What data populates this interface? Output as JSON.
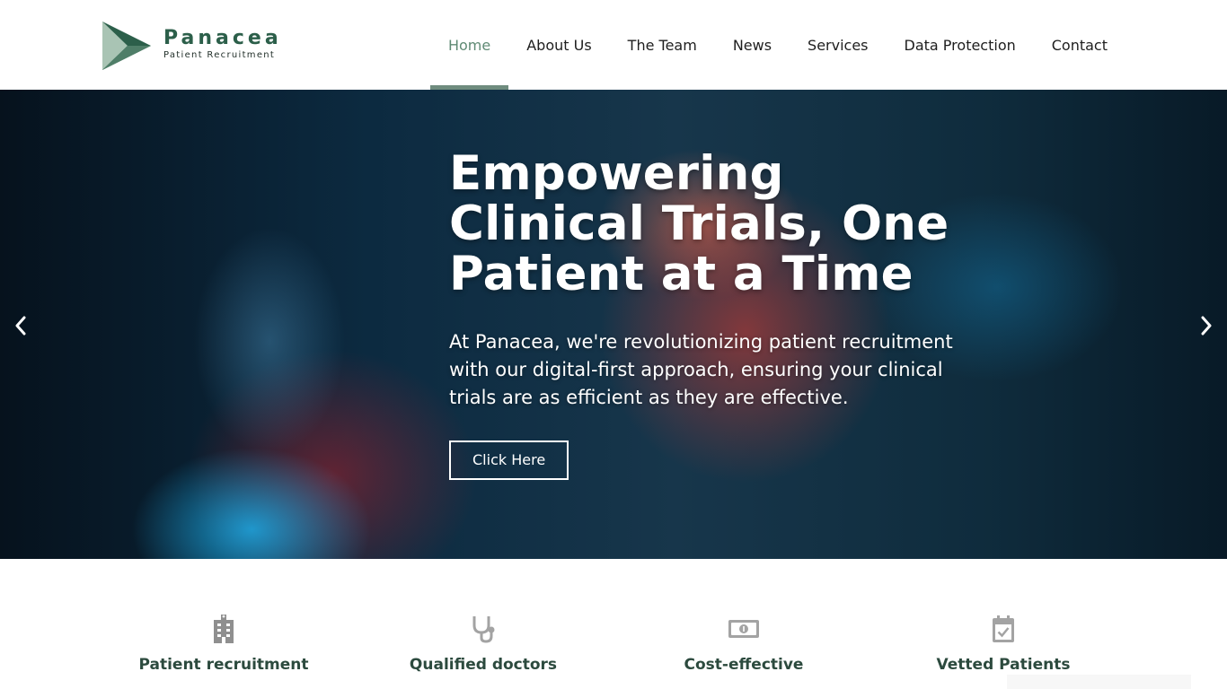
{
  "logo": {
    "name": "Panacea",
    "tagline": "Patient Recruitment"
  },
  "nav": {
    "items": [
      {
        "label": "Home",
        "active": true
      },
      {
        "label": "About Us",
        "active": false
      },
      {
        "label": "The Team",
        "active": false
      },
      {
        "label": "News",
        "active": false
      },
      {
        "label": "Services",
        "active": false
      },
      {
        "label": "Data Protection",
        "active": false
      },
      {
        "label": "Contact",
        "active": false
      }
    ]
  },
  "hero": {
    "title": "Empowering Clinical Trials, One Patient at a Time",
    "text": "At Panacea, we're revolutionizing patient recruitment with our digital-first approach, ensuring your clinical trials are as efficient as they are effective.",
    "button_label": "Click Here"
  },
  "features": [
    {
      "icon": "hospital-icon",
      "label": "Patient recruitment"
    },
    {
      "icon": "stethoscope-icon",
      "label": "Qualified doctors"
    },
    {
      "icon": "money-bill-icon",
      "label": "Cost-effective"
    },
    {
      "icon": "calendar-check-icon",
      "label": "Vetted Patients"
    }
  ],
  "colors": {
    "brand_green": "#2c5f4a",
    "nav_active": "#5f8a74",
    "icon_gray": "#9a9a9a"
  }
}
